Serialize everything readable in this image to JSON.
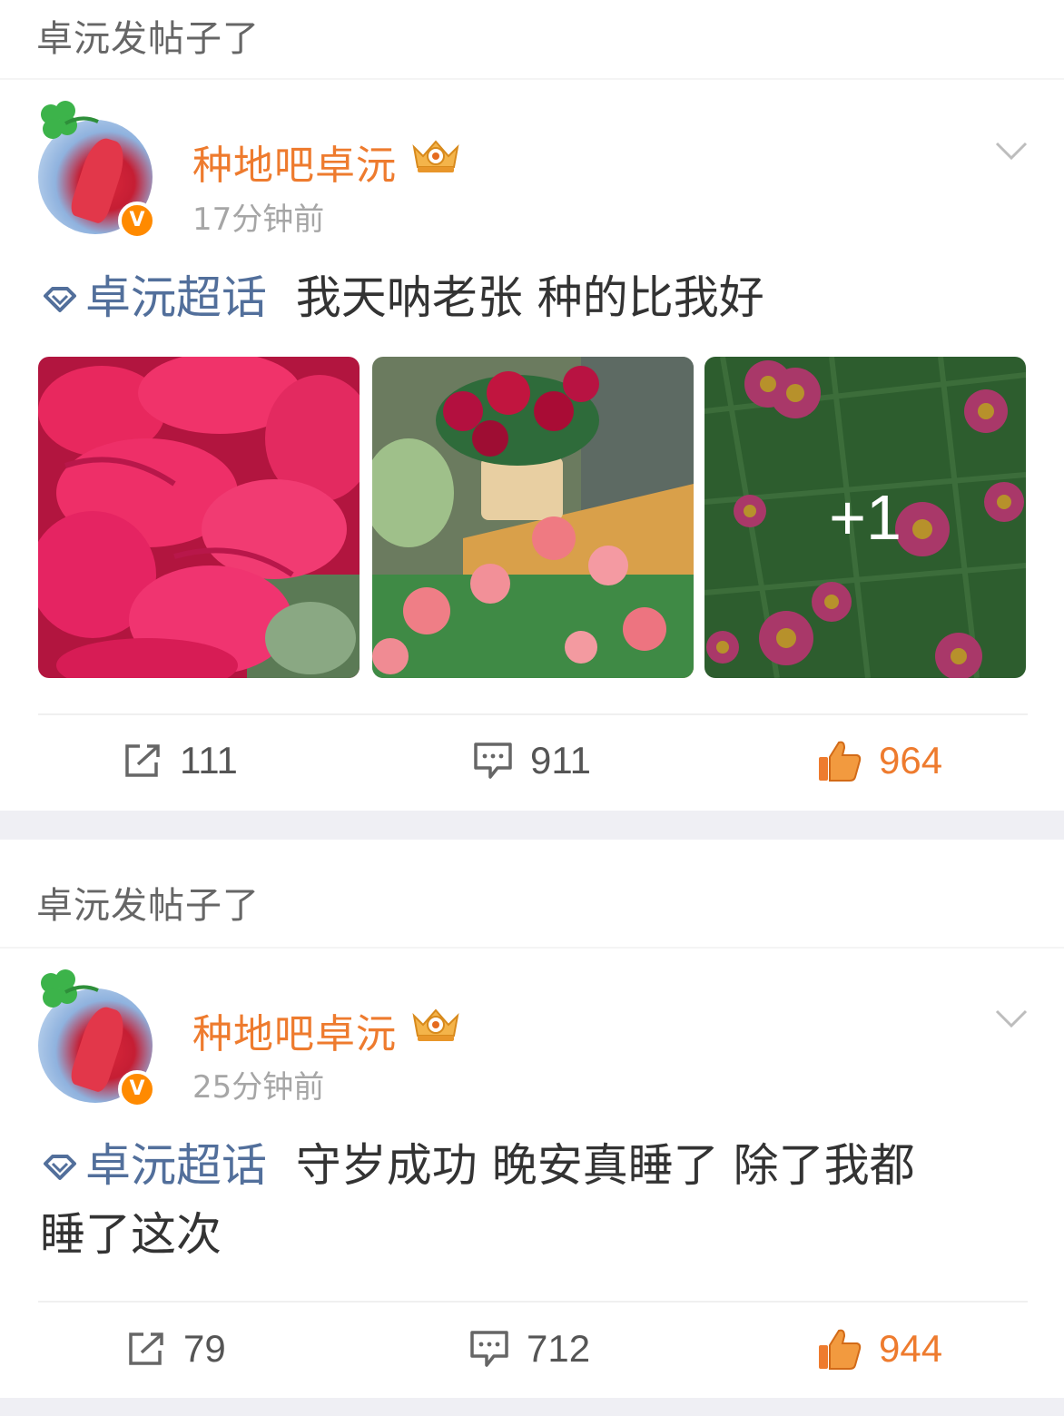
{
  "posts": [
    {
      "header": "卓沅发帖子了",
      "username": "种地吧卓沅",
      "time": "17分钟前",
      "topic": "卓沅超话",
      "text": "我天呐老张 种的比我好",
      "text_line2": "",
      "photo_more": "+1",
      "repost_count": "111",
      "comment_count": "911",
      "like_count": "964"
    },
    {
      "header": "卓沅发帖子了",
      "username": "种地吧卓沅",
      "time": "25分钟前",
      "topic": "卓沅超话",
      "text": "守岁成功 晚安真睡了 除了我都",
      "text_line2": "睡了这次",
      "repost_count": "79",
      "comment_count": "712",
      "like_count": "944"
    }
  ],
  "verify_badge": "V",
  "colors": {
    "username": "#ee7b2e",
    "topic": "#526f9b",
    "like": "#ee7b2e",
    "background": "#efeff4"
  },
  "icons": [
    "clover-icon",
    "crown-badge-icon",
    "chevron-down-icon",
    "super-topic-icon",
    "repost-icon",
    "comment-icon",
    "like-icon"
  ]
}
